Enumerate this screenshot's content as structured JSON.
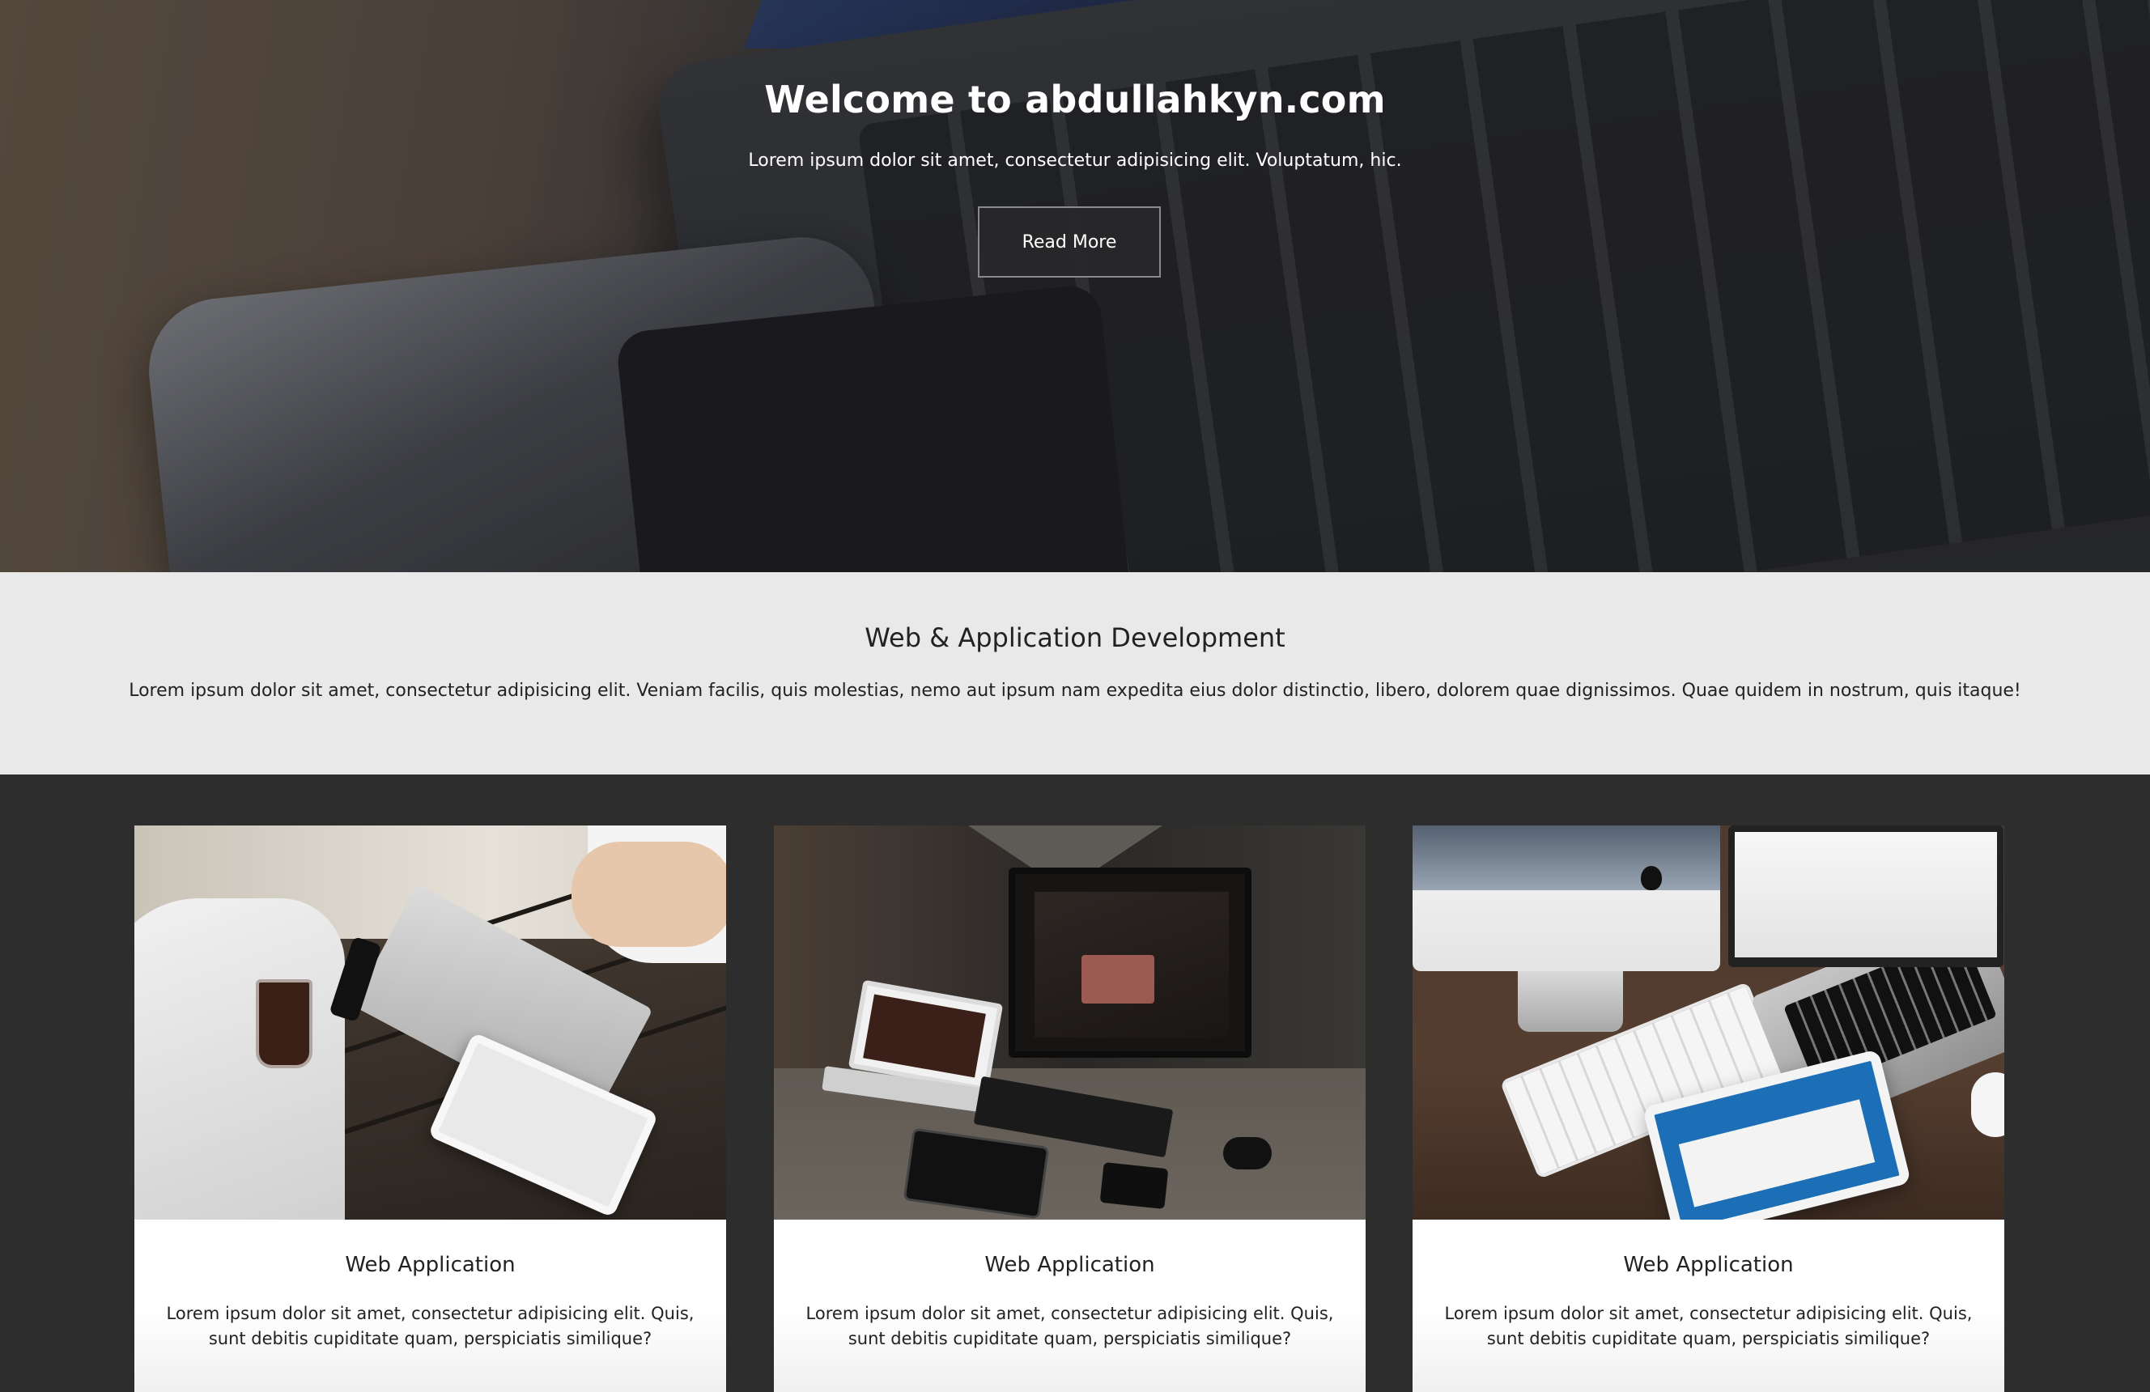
{
  "hero": {
    "title": "Welcome to abdullahkyn.com",
    "subtitle": "Lorem ipsum dolor sit amet, consectetur adipisicing elit. Voluptatum, hic.",
    "button_label": "Read More"
  },
  "intro": {
    "title": "Web & Application Development",
    "text": "Lorem ipsum dolor sit amet, consectetur adipisicing elit. Veniam facilis, quis molestias, nemo aut ipsum nam expedita eius dolor distinctio, libero, dolorem quae dignissimos. Quae quidem in nostrum, quis itaque!"
  },
  "cards": [
    {
      "title": "Web Application",
      "text": "Lorem ipsum dolor sit amet, consectetur adipisicing elit. Quis, sunt debitis cupiditate quam, perspiciatis similique?"
    },
    {
      "title": "Web Application",
      "text": "Lorem ipsum dolor sit amet, consectetur adipisicing elit. Quis, sunt debitis cupiditate quam, perspiciatis similique?"
    },
    {
      "title": "Web Application",
      "text": "Lorem ipsum dolor sit amet, consectetur adipisicing elit. Quis, sunt debitis cupiditate quam, perspiciatis similique?"
    }
  ],
  "colors": {
    "hero_text": "#ffffff",
    "intro_background": "#e9e9e9",
    "cards_background": "#2d2d2d",
    "card_background": "#ffffff",
    "button_background": "#2a2a2b",
    "button_border": "#8a8a8a"
  }
}
